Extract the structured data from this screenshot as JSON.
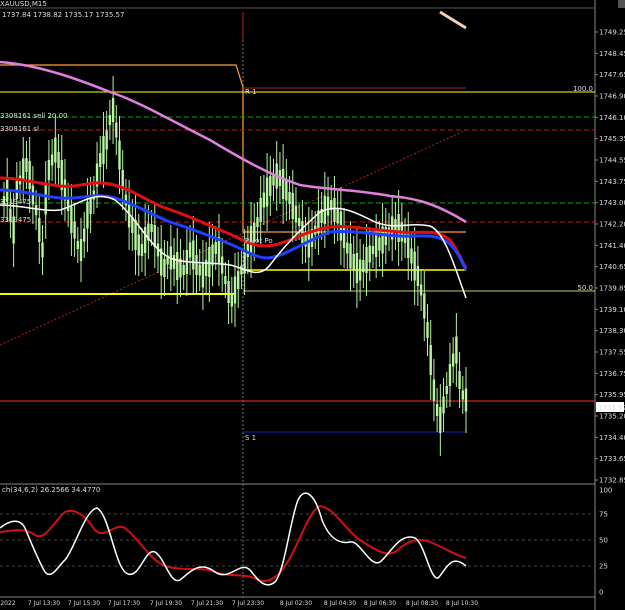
{
  "header": {
    "symbol_line": "XAUUSD,M15",
    "ohlc_line": "1737.84 1738.82 1735.17 1735.57"
  },
  "indicator_header": "ch(34,6,2) 26.2566 34.4770",
  "price_axis": {
    "ticks": [
      "1749.25",
      "1748.45",
      "1747.65",
      "1746.90",
      "1746.10",
      "1745.35",
      "1744.55",
      "1743.75",
      "1743.00",
      "1742.20",
      "1741.40",
      "1740.65",
      "1739.85",
      "1739.10",
      "1738.30",
      "1737.55",
      "1736.75",
      "1735.95",
      "1735.20",
      "1734.40",
      "1733.65",
      "1732.85"
    ],
    "current_price": "1735.57"
  },
  "indicator_axis": {
    "ticks": [
      "100",
      "75",
      "50",
      "25",
      "0"
    ]
  },
  "time_axis": {
    "labels": [
      "2022",
      "7 Jul 13:30",
      "7 Jul 15:30",
      "7 Jul 17:30",
      "7 Jul 19:30",
      "7 Jul 21:30",
      "7 Jul 23:30",
      "8 Jul 02:30",
      "8 Jul 04:30",
      "8 Jul 06:30",
      "8 Jul 08:30",
      "8 Jul 10:30"
    ]
  },
  "annotations": {
    "order_sell": "3308161 sell 20.00",
    "order_sl": "3308161 sl",
    "pos_line_1": "3319475",
    "pos_line_2": "3319475",
    "r1_label": "R 1",
    "pivot_label": "Pivot Po",
    "s1_label": "S 1",
    "level_100": "100.0",
    "level_50": "50.0"
  },
  "colors": {
    "background": "#000000",
    "bull_candle": "#b8f5a0",
    "ma_pink": "#e07fe0",
    "ma_red": "#e01010",
    "ma_blue": "#2040ff",
    "ma_white": "#ffffff",
    "fib_yellow": "#ffff00",
    "pivot_orange": "#ffa040",
    "order_red": "#c01818",
    "order_green": "#10a010",
    "s1_blue": "#1020c0",
    "trend_red": "#b02020"
  }
}
